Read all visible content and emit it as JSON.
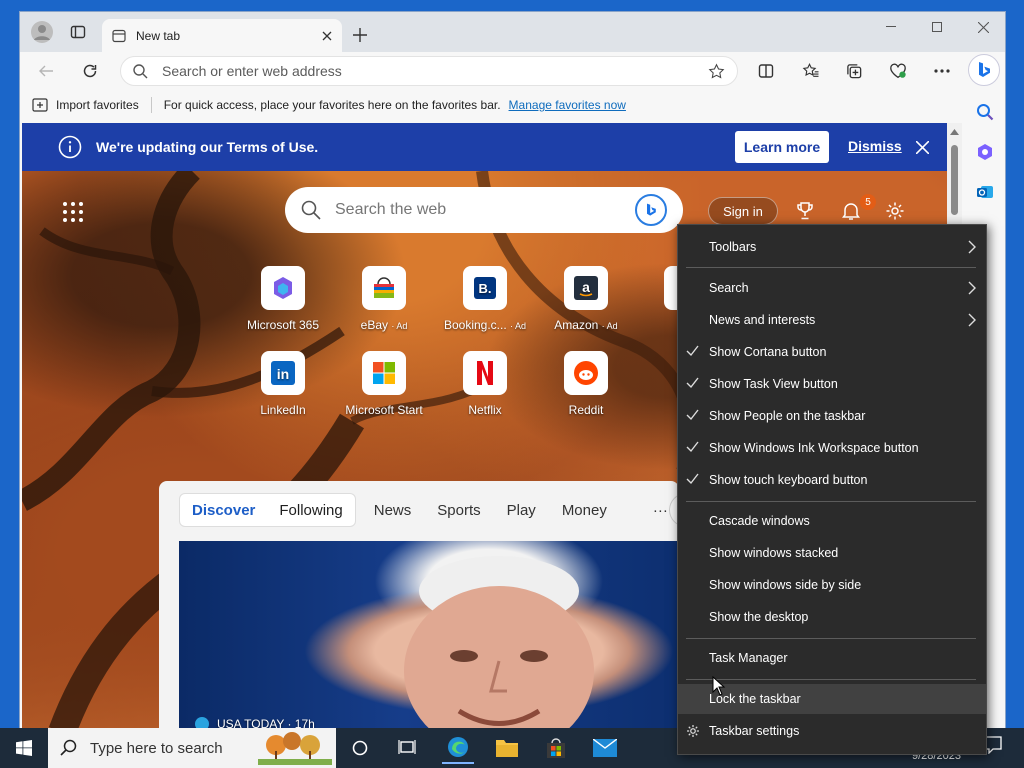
{
  "browser": {
    "tab_title": "New tab",
    "address_placeholder": "Search or enter web address",
    "favorites_bar": {
      "import_label": "Import favorites",
      "hint": "For quick access, place your favorites here on the favorites bar.",
      "manage_link": "Manage favorites now"
    }
  },
  "banner": {
    "message": "We're updating our Terms of Use.",
    "learn_more": "Learn more",
    "dismiss": "Dismiss"
  },
  "newtab": {
    "search_placeholder": "Search the web",
    "sign_in": "Sign in",
    "notification_count": "5",
    "sites": [
      {
        "label": "Microsoft 365",
        "ad": ""
      },
      {
        "label": "eBay",
        "ad": "· Ad"
      },
      {
        "label": "Booking.c...",
        "ad": "· Ad"
      },
      {
        "label": "Amazon",
        "ad": "· Ad"
      },
      {
        "label": "LinkedIn",
        "ad": ""
      },
      {
        "label": "Microsoft Start",
        "ad": ""
      },
      {
        "label": "Netflix",
        "ad": ""
      },
      {
        "label": "Reddit",
        "ad": ""
      }
    ],
    "feed": {
      "tabs_pill": [
        "Discover",
        "Following"
      ],
      "tabs": [
        "News",
        "Sports",
        "Play",
        "Money"
      ],
      "more": "···",
      "article_source": "USA TODAY · 17h"
    }
  },
  "taskbar": {
    "search_placeholder": "Type here to search",
    "date": "9/28/2023"
  },
  "context_menu": {
    "items": [
      {
        "label": "Toolbars",
        "checked": false,
        "submenu": true
      },
      {
        "label": "Search",
        "checked": false,
        "submenu": true
      },
      {
        "label": "News and interests",
        "checked": false,
        "submenu": true
      },
      {
        "label": "Show Cortana button",
        "checked": true,
        "submenu": false
      },
      {
        "label": "Show Task View button",
        "checked": true,
        "submenu": false
      },
      {
        "label": "Show People on the taskbar",
        "checked": true,
        "submenu": false
      },
      {
        "label": "Show Windows Ink Workspace button",
        "checked": true,
        "submenu": false
      },
      {
        "label": "Show touch keyboard button",
        "checked": true,
        "submenu": false
      },
      {
        "label": "Cascade windows",
        "checked": false,
        "submenu": false
      },
      {
        "label": "Show windows stacked",
        "checked": false,
        "submenu": false
      },
      {
        "label": "Show windows side by side",
        "checked": false,
        "submenu": false
      },
      {
        "label": "Show the desktop",
        "checked": false,
        "submenu": false
      },
      {
        "label": "Task Manager",
        "checked": false,
        "submenu": false
      },
      {
        "label": "Lock the taskbar",
        "checked": false,
        "submenu": false,
        "highlighted": true
      },
      {
        "label": "Taskbar settings",
        "checked": false,
        "submenu": false,
        "gear": true
      }
    ]
  },
  "colors": {
    "desktop": "#1b66c9",
    "banner": "#1d3fa8",
    "menu_bg": "#2b2b2b",
    "link": "#0f6cbd"
  }
}
